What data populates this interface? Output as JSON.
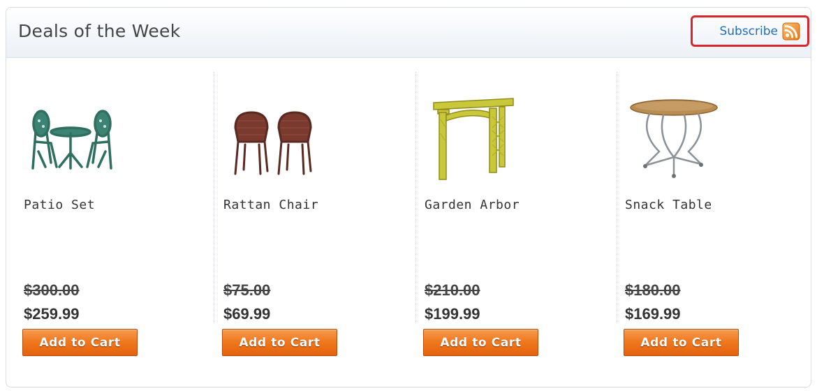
{
  "header": {
    "title": "Deals of the Week",
    "subscribe_label": "Subscribe"
  },
  "icons": {
    "feed": "rss-feed-icon"
  },
  "colors": {
    "subscribe_highlight": "#d6262e",
    "link": "#1f6fb6",
    "button_orange": "#f0791f",
    "rss_orange": "#f39a32"
  },
  "products": [
    {
      "name": "Patio Set",
      "old_price": "$300.00",
      "new_price": "$259.99",
      "button_label": "Add to Cart"
    },
    {
      "name": "Rattan Chair",
      "old_price": "$75.00",
      "new_price": "$69.99",
      "button_label": "Add to Cart"
    },
    {
      "name": "Garden Arbor",
      "old_price": "$210.00",
      "new_price": "$199.99",
      "button_label": "Add to Cart"
    },
    {
      "name": "Snack Table",
      "old_price": "$180.00",
      "new_price": "$169.99",
      "button_label": "Add to Cart"
    }
  ]
}
